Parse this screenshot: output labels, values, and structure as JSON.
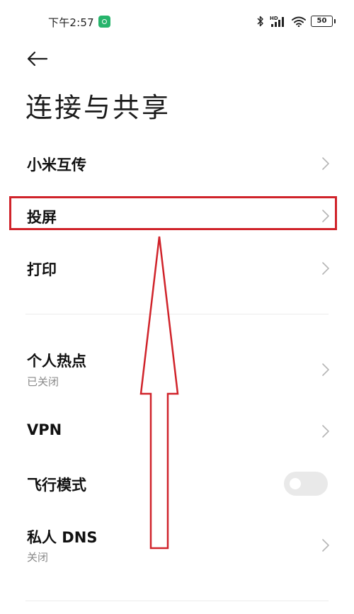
{
  "status_bar": {
    "time": "下午2:57",
    "signal_label": "HD",
    "battery_level": "50",
    "icons": [
      "app-notification-icon",
      "bluetooth-icon",
      "hd-signal-icon",
      "wifi-icon",
      "battery-icon"
    ]
  },
  "header": {
    "back_icon": "back-arrow-icon",
    "title": "连接与共享"
  },
  "items": [
    {
      "label": "小米互传",
      "has_chevron": true
    },
    {
      "label": "投屏",
      "has_chevron": true,
      "highlighted": true
    },
    {
      "label": "打印",
      "has_chevron": true
    },
    {
      "label": "个人热点",
      "subtitle": "已关闭",
      "has_chevron": true
    },
    {
      "label": "VPN",
      "has_chevron": true
    },
    {
      "label": "飞行模式",
      "toggle_on": false
    },
    {
      "label": "私人 DNS",
      "subtitle": "关闭",
      "has_chevron": true
    }
  ],
  "colors": {
    "annotation": "#d0232a",
    "app_badge": "#26b46b",
    "toggle_track": "#e9e9e9",
    "subtitle_text": "#8a8a8a"
  }
}
